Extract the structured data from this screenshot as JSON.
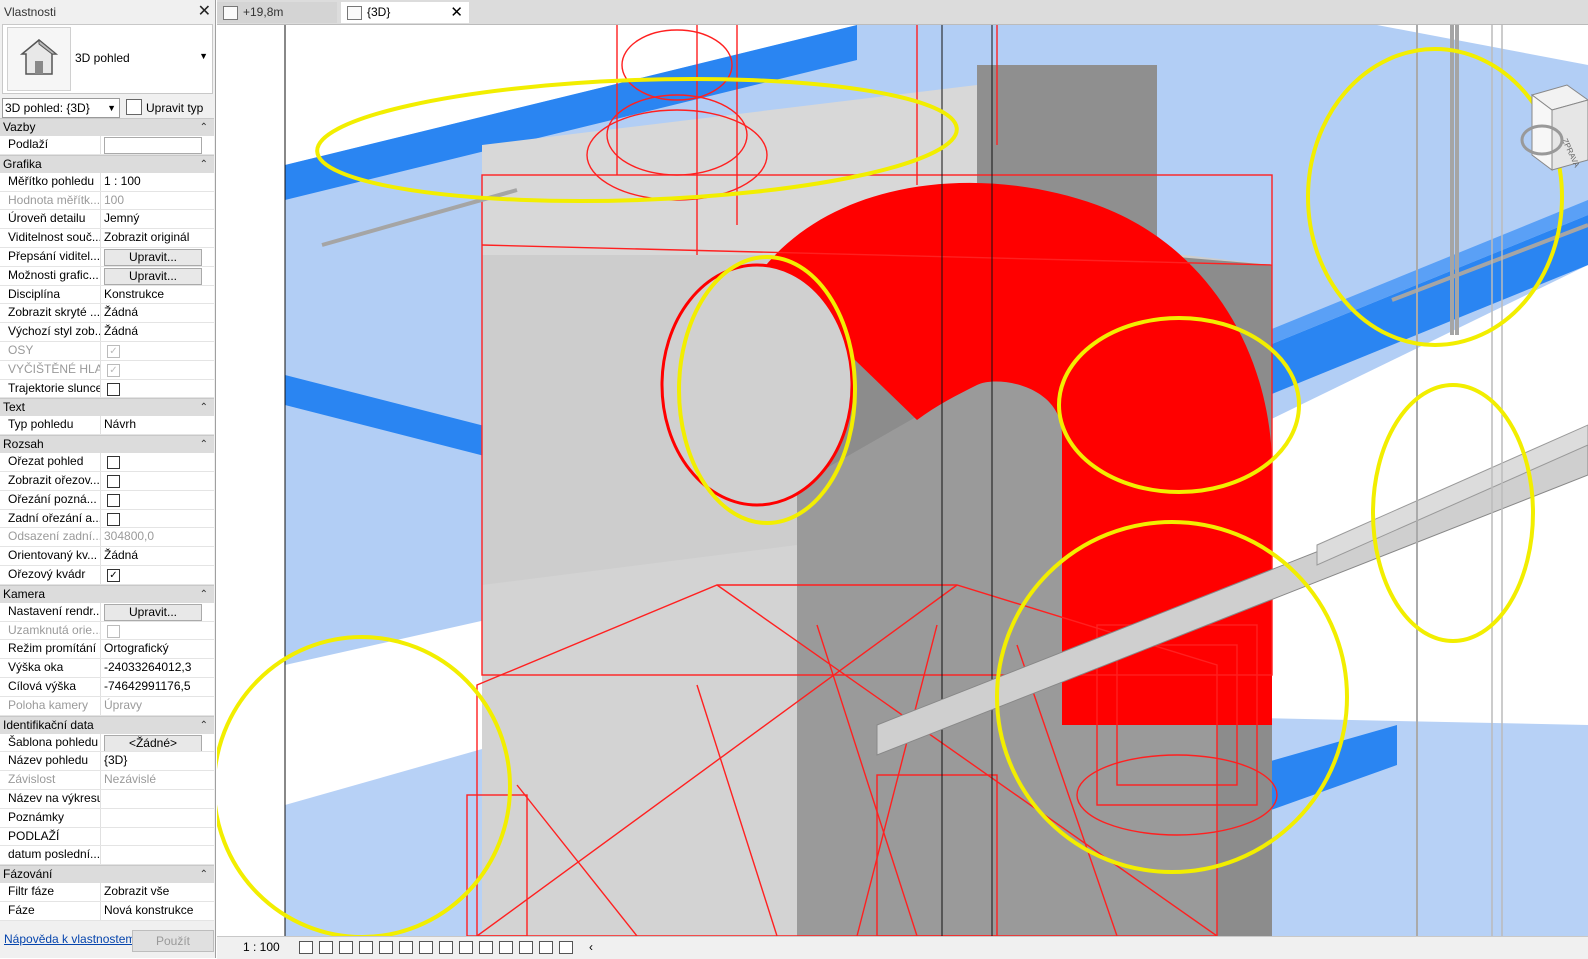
{
  "panel": {
    "title": "Vlastnosti",
    "type_name": "3D pohled",
    "view_selector": "3D pohled: {3D}",
    "edit_type": "Upravit typ",
    "help_link": "Nápověda k vlastnostem",
    "apply": "Použít"
  },
  "sections": [
    {
      "name": "Vazby",
      "rows": [
        {
          "k": "Podlaží",
          "v": "",
          "kind": "textbox"
        }
      ]
    },
    {
      "name": "Grafika",
      "rows": [
        {
          "k": "Měřítko pohledu",
          "v": "1 : 100"
        },
        {
          "k": "Hodnota měřítk...",
          "v": "100",
          "dis": true
        },
        {
          "k": "Úroveň detailu",
          "v": "Jemný"
        },
        {
          "k": "Viditelnost souč...",
          "v": "Zobrazit originál"
        },
        {
          "k": "Přepsání viditel...",
          "v": "Upravit...",
          "kind": "button"
        },
        {
          "k": "Možnosti grafic...",
          "v": "Upravit...",
          "kind": "button"
        },
        {
          "k": "Disciplína",
          "v": "Konstrukce"
        },
        {
          "k": "Zobrazit skryté ...",
          "v": "Žádná"
        },
        {
          "k": "Výchozí styl zob...",
          "v": "Žádná"
        },
        {
          "k": "OSY",
          "v": "",
          "kind": "check",
          "checked": true,
          "dis": true
        },
        {
          "k": "VYČIŠTĚNÉ HLA...",
          "v": "",
          "kind": "check",
          "checked": true,
          "dis": true
        },
        {
          "k": "Trajektorie slunce",
          "v": "",
          "kind": "check",
          "checked": false
        }
      ]
    },
    {
      "name": "Text",
      "rows": [
        {
          "k": "Typ pohledu",
          "v": "Návrh"
        }
      ]
    },
    {
      "name": "Rozsah",
      "rows": [
        {
          "k": "Ořezat pohled",
          "v": "",
          "kind": "check",
          "checked": false
        },
        {
          "k": "Zobrazit ořezov...",
          "v": "",
          "kind": "check",
          "checked": false
        },
        {
          "k": "Ořezání pozná...",
          "v": "",
          "kind": "check",
          "checked": false
        },
        {
          "k": "Zadní ořezání a...",
          "v": "",
          "kind": "check",
          "checked": false
        },
        {
          "k": "Odsazení zadní...",
          "v": "304800,0",
          "dis": true
        },
        {
          "k": "Orientovaný kv...",
          "v": "Žádná"
        },
        {
          "k": "Ořezový kvádr",
          "v": "",
          "kind": "check",
          "checked": true
        }
      ]
    },
    {
      "name": "Kamera",
      "rows": [
        {
          "k": "Nastavení rendr...",
          "v": "Upravit...",
          "kind": "button"
        },
        {
          "k": "Uzamknutá orie...",
          "v": "",
          "kind": "check",
          "checked": false,
          "dis": true
        },
        {
          "k": "Režim promítání",
          "v": "Ortografický"
        },
        {
          "k": "Výška oka",
          "v": "-24033264012,3"
        },
        {
          "k": "Cílová výška",
          "v": "-74642991176,5"
        },
        {
          "k": "Poloha kamery",
          "v": "Úpravy",
          "dis": true
        }
      ]
    },
    {
      "name": "Identifikační data",
      "rows": [
        {
          "k": "Šablona pohledu",
          "v": "<Žádné>",
          "kind": "button"
        },
        {
          "k": "Název pohledu",
          "v": "{3D}"
        },
        {
          "k": "Závislost",
          "v": "Nezávislé",
          "dis": true
        },
        {
          "k": "Název na výkresu",
          "v": ""
        },
        {
          "k": "Poznámky",
          "v": ""
        },
        {
          "k": "PODLAŽÍ",
          "v": ""
        },
        {
          "k": "datum poslední...",
          "v": ""
        }
      ]
    },
    {
      "name": "Fázování",
      "rows": [
        {
          "k": "Filtr fáze",
          "v": "Zobrazit vše"
        },
        {
          "k": "Fáze",
          "v": "Nová konstrukce"
        }
      ]
    }
  ],
  "tabs": [
    {
      "label": "+19,8m",
      "icon": "floor-plan-icon"
    },
    {
      "label": "{3D}",
      "icon": "3d-view-icon",
      "active": true
    }
  ],
  "status": {
    "scale": "1 : 100"
  },
  "viewcube": {
    "face": "ZPRAVA"
  },
  "colors": {
    "slab": "#a9c8f5",
    "beam": "#1e7ef0",
    "pipe_red": "#ff0000",
    "concrete": "#c6c6c6",
    "concrete_dark": "#8c8c8c",
    "highlight": "#ffee00"
  }
}
